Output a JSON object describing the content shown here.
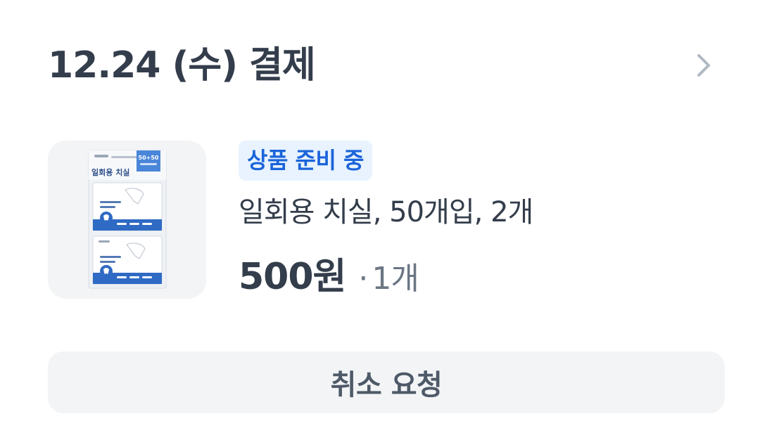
{
  "order": {
    "date_title": "12.24 (수) 결제",
    "detail_icon": "chevron-right-icon"
  },
  "product": {
    "status": "상품 준비 중",
    "name": "일회용 치실, 50개입, 2개",
    "price": "500원",
    "quantity_separator": "·",
    "quantity": "1개",
    "thumbnail_icon": "floss-package-image",
    "thumbnail_package_title": "일회용 치실",
    "thumbnail_badge": "50+50"
  },
  "actions": {
    "cancel_label": "취소 요청"
  },
  "colors": {
    "text_primary": "#333d4b",
    "text_secondary": "#6b7684",
    "badge_bg": "#e8f3ff",
    "badge_text": "#1b64da",
    "button_bg": "#f2f4f6",
    "chevron": "#b0b8c1"
  }
}
